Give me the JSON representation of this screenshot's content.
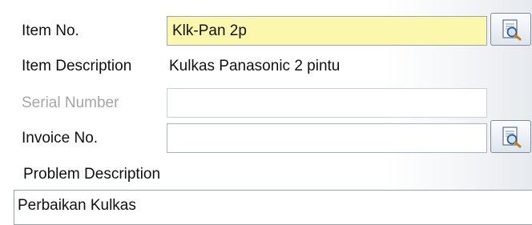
{
  "form": {
    "item_no": {
      "label": "Item No.",
      "value": "Klk-Pan 2p"
    },
    "item_description": {
      "label": "Item Description",
      "value": "Kulkas Panasonic 2 pintu"
    },
    "serial_number": {
      "label": "Serial Number",
      "value": ""
    },
    "invoice_no": {
      "label": "Invoice No.",
      "value": ""
    },
    "problem_description": {
      "label": "Problem Description",
      "value": "Perbaikan Kulkas"
    }
  },
  "icons": {
    "lookup": "search-document-icon"
  },
  "colors": {
    "required_field": "#fbf7ad",
    "disabled_text": "#a6a6a6",
    "border": "#a9b3c1"
  }
}
